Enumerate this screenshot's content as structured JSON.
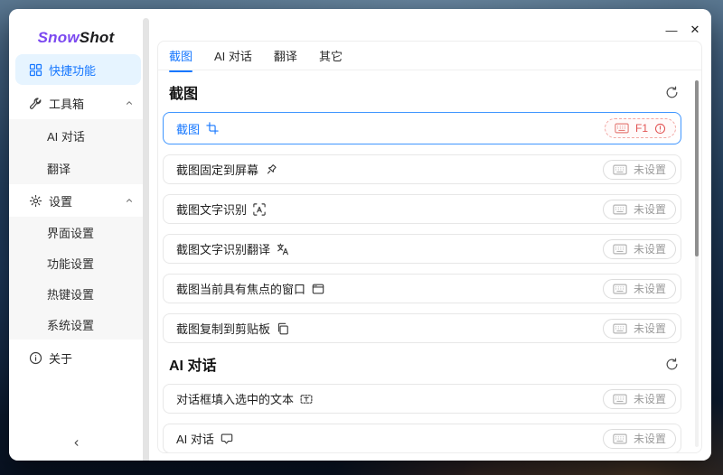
{
  "brand": {
    "part1": "Snow",
    "part2": "Shot"
  },
  "window": {
    "minimize": "—",
    "close": "✕"
  },
  "colors": {
    "accent": "#1677ff",
    "active_row_border": "#4096ff",
    "warning_text": "#e25555",
    "warning_border": "#f2a7a3",
    "sidebar_active_bg": "#e6f4ff",
    "logo_purple": "#7b48f0",
    "row_border": "#e7e7e7",
    "tag_border": "#dcdcdc",
    "tag_text": "#9a9a9a"
  },
  "sidebar": {
    "items": [
      {
        "label": "快捷功能",
        "icon": "appstore-icon",
        "active": true
      },
      {
        "label": "工具箱",
        "icon": "tool-icon",
        "expanded": true
      },
      {
        "label": "AI 对话"
      },
      {
        "label": "翻译"
      },
      {
        "label": "设置",
        "icon": "gear-icon",
        "expanded": true
      },
      {
        "label": "界面设置"
      },
      {
        "label": "功能设置"
      },
      {
        "label": "热键设置"
      },
      {
        "label": "系统设置"
      },
      {
        "label": "关于",
        "icon": "info-circle-icon"
      }
    ]
  },
  "tabs": [
    {
      "label": "截图",
      "active": true
    },
    {
      "label": "AI 对话"
    },
    {
      "label": "翻译"
    },
    {
      "label": "其它"
    }
  ],
  "sections": [
    {
      "title": "截图",
      "rows": [
        {
          "label": "截图",
          "icon": "crop-icon",
          "shortcut": "F1",
          "status": "warning",
          "active": true
        },
        {
          "label": "截图固定到屏幕",
          "icon": "pin-icon",
          "shortcut": "未设置",
          "status": "unset"
        },
        {
          "label": "截图文字识别",
          "icon": "ocr-icon",
          "shortcut": "未设置",
          "status": "unset"
        },
        {
          "label": "截图文字识别翻译",
          "icon": "translate-icon",
          "shortcut": "未设置",
          "status": "unset"
        },
        {
          "label": "截图当前具有焦点的窗口",
          "icon": "window-icon",
          "shortcut": "未设置",
          "status": "unset"
        },
        {
          "label": "截图复制到剪贴板",
          "icon": "copy-icon",
          "shortcut": "未设置",
          "status": "unset"
        }
      ]
    },
    {
      "title": "AI 对话",
      "rows": [
        {
          "label": "对话框填入选中的文本",
          "icon": "text-select-icon",
          "shortcut": "未设置",
          "status": "unset"
        },
        {
          "label": "AI 对话",
          "icon": "chat-icon",
          "shortcut": "未设置",
          "status": "unset"
        }
      ]
    }
  ]
}
